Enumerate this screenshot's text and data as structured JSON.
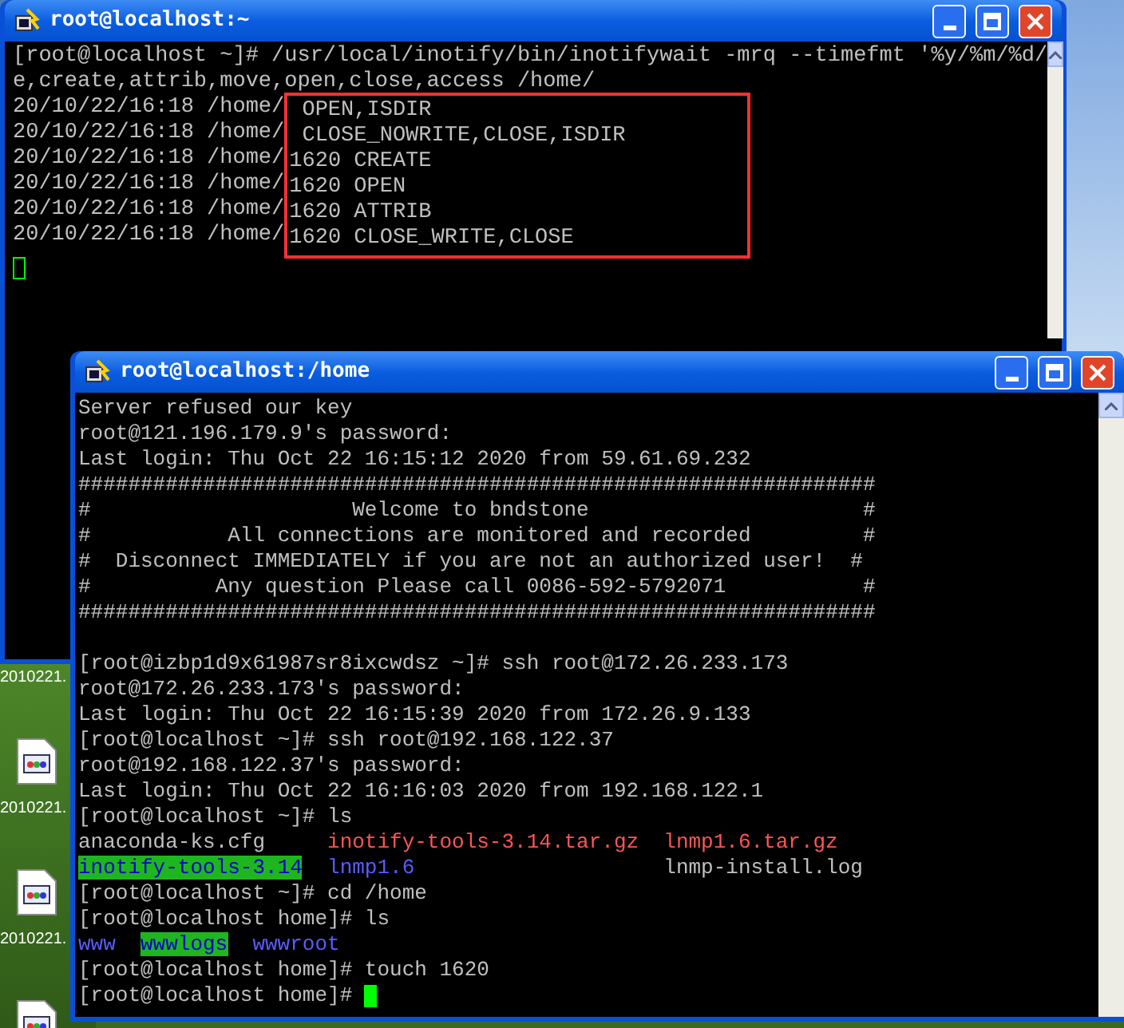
{
  "desktop": {
    "icons": [
      {
        "label": "2010221."
      },
      {
        "label": "2010221."
      },
      {
        "label": "2010221."
      }
    ]
  },
  "windows": [
    {
      "title": "root@localhost:~",
      "cursor": true,
      "lines": [
        {
          "kind": "text",
          "segments": [
            {
              "kind": "plain",
              "text": "[root@localhost ~]# /usr/local/inotify/bin/inotifywait -mrq --timefmt '%y/%m/%d/"
            }
          ]
        },
        {
          "kind": "text",
          "segments": [
            {
              "kind": "plain",
              "text": "e,create,attrib,move,open,close,access /home/"
            }
          ]
        }
      ],
      "events_boxed": true,
      "events": [
        {
          "stamp": "20/10/22/16:18 /home/",
          "event": "OPEN,ISDIR"
        },
        {
          "stamp": "20/10/22/16:18 /home/",
          "event": "CLOSE_NOWRITE,CLOSE,ISDIR"
        },
        {
          "stamp": "20/10/22/16:18 /home/",
          "name": "1620",
          "event": "CREATE"
        },
        {
          "stamp": "20/10/22/16:18 /home/",
          "name": "1620",
          "event": "OPEN"
        },
        {
          "stamp": "20/10/22/16:18 /home/",
          "name": "1620",
          "event": "ATTRIB"
        },
        {
          "stamp": "20/10/22/16:18 /home/",
          "name": "1620",
          "event": "CLOSE_WRITE,CLOSE"
        }
      ]
    },
    {
      "title": "root@localhost:/home",
      "cursor": true,
      "lines": [
        {
          "kind": "text",
          "segments": [
            {
              "kind": "plain",
              "text": "Server refused our key"
            }
          ]
        },
        {
          "kind": "text",
          "segments": [
            {
              "kind": "plain",
              "text": "root@121.196.179.9's password:"
            }
          ]
        },
        {
          "kind": "text",
          "segments": [
            {
              "kind": "plain",
              "text": "Last login: Thu Oct 22 16:15:12 2020 from 59.61.69.232"
            }
          ]
        },
        {
          "kind": "text",
          "segments": [
            {
              "kind": "plain",
              "text": "################################################################"
            }
          ]
        },
        {
          "kind": "text",
          "segments": [
            {
              "kind": "plain",
              "text": "#                     Welcome to bndstone                      #"
            }
          ]
        },
        {
          "kind": "text",
          "segments": [
            {
              "kind": "plain",
              "text": "#           All connections are monitored and recorded         #"
            }
          ]
        },
        {
          "kind": "text",
          "segments": [
            {
              "kind": "plain",
              "text": "#  Disconnect IMMEDIATELY if you are not an authorized user!  #"
            }
          ]
        },
        {
          "kind": "text",
          "segments": [
            {
              "kind": "plain",
              "text": "#          Any question Please call 0086-592-5792071           #"
            }
          ]
        },
        {
          "kind": "text",
          "segments": [
            {
              "kind": "plain",
              "text": "################################################################"
            }
          ]
        },
        {
          "kind": "blank"
        },
        {
          "kind": "text",
          "segments": [
            {
              "kind": "plain",
              "text": "[root@izbp1d9x61987sr8ixcwdsz ~]# ssh root@172.26.233.173"
            }
          ]
        },
        {
          "kind": "text",
          "segments": [
            {
              "kind": "plain",
              "text": "root@172.26.233.173's password:"
            }
          ]
        },
        {
          "kind": "text",
          "segments": [
            {
              "kind": "plain",
              "text": "Last login: Thu Oct 22 16:15:39 2020 from 172.26.9.133"
            }
          ]
        },
        {
          "kind": "text",
          "segments": [
            {
              "kind": "plain",
              "text": "[root@localhost ~]# ssh root@192.168.122.37"
            }
          ]
        },
        {
          "kind": "text",
          "segments": [
            {
              "kind": "plain",
              "text": "root@192.168.122.37's password:"
            }
          ]
        },
        {
          "kind": "text",
          "segments": [
            {
              "kind": "plain",
              "text": "Last login: Thu Oct 22 16:16:03 2020 from 192.168.122.1"
            }
          ]
        },
        {
          "kind": "text",
          "segments": [
            {
              "kind": "plain",
              "text": "[root@localhost ~]# ls"
            }
          ]
        },
        {
          "kind": "listing",
          "rows": [
            [
              {
                "kind": "plain",
                "text": "anaconda-ks.cfg"
              },
              {
                "kind": "archive",
                "text": "inotify-tools-3.14.tar.gz"
              },
              {
                "kind": "archive",
                "text": "lnmp1.6.tar.gz"
              }
            ],
            [
              {
                "kind": "highlighted-directory",
                "text": "inotify-tools-3.14"
              },
              {
                "kind": "directory",
                "text": "lnmp1.6"
              },
              {
                "kind": "plain",
                "text": "lnmp-install.log"
              }
            ]
          ]
        },
        {
          "kind": "text",
          "segments": [
            {
              "kind": "plain",
              "text": "[root@localhost ~]# cd /home"
            }
          ]
        },
        {
          "kind": "text",
          "segments": [
            {
              "kind": "plain",
              "text": "[root@localhost home]# ls"
            }
          ]
        },
        {
          "kind": "listing",
          "rows": [
            [
              {
                "kind": "directory",
                "text": "www"
              },
              {
                "kind": "highlighted-directory",
                "text": "wwwlogs"
              },
              {
                "kind": "directory",
                "text": "wwwroot"
              }
            ]
          ]
        },
        {
          "kind": "text",
          "segments": [
            {
              "kind": "plain",
              "text": "[root@localhost home]# touch 1620"
            }
          ]
        },
        {
          "kind": "text",
          "segments": [
            {
              "kind": "plain",
              "text": "[root@localhost home]# "
            }
          ]
        }
      ]
    }
  ]
}
